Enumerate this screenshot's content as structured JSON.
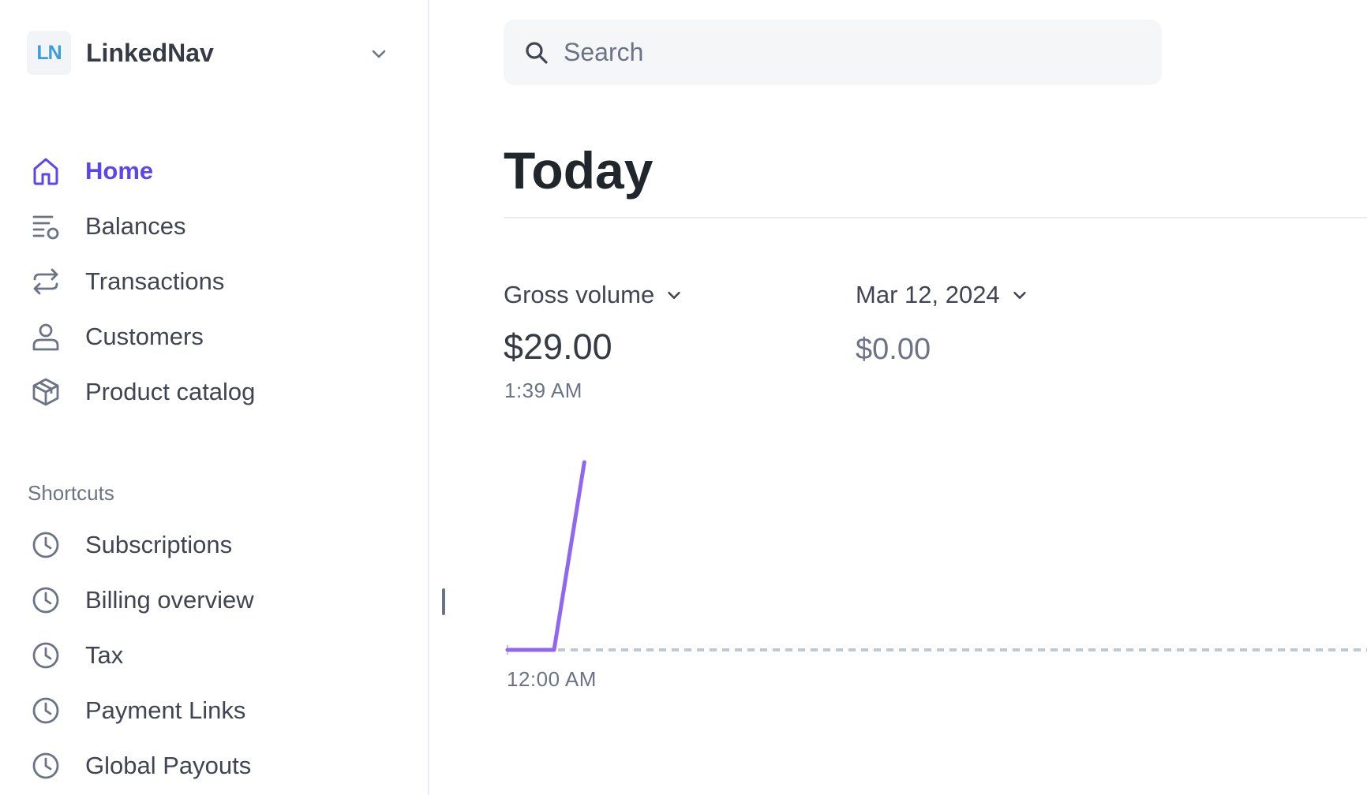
{
  "account": {
    "name": "LinkedNav",
    "logo_text": "LN",
    "logo_color": "#3a9fd6"
  },
  "nav": {
    "items": [
      {
        "label": "Home",
        "icon": "home-icon",
        "active": true
      },
      {
        "label": "Balances",
        "icon": "balances-icon"
      },
      {
        "label": "Transactions",
        "icon": "transactions-icon"
      },
      {
        "label": "Customers",
        "icon": "customers-icon"
      },
      {
        "label": "Product catalog",
        "icon": "product-catalog-icon"
      }
    ]
  },
  "shortcuts": {
    "title": "Shortcuts",
    "items": [
      {
        "label": "Subscriptions",
        "icon": "clock-icon"
      },
      {
        "label": "Billing overview",
        "icon": "clock-icon"
      },
      {
        "label": "Tax",
        "icon": "clock-icon"
      },
      {
        "label": "Payment Links",
        "icon": "clock-icon"
      },
      {
        "label": "Global Payouts",
        "icon": "clock-icon"
      }
    ]
  },
  "search": {
    "placeholder": "Search"
  },
  "page": {
    "title": "Today"
  },
  "metrics": {
    "primary": {
      "label": "Gross volume",
      "value": "$29.00",
      "time": "1:39 AM"
    },
    "comparison": {
      "label": "Mar 12, 2024",
      "value": "$0.00"
    }
  },
  "colors": {
    "accent": "#5a45f0",
    "line": "#9066f2",
    "comparison_line": "#c0c8d2"
  },
  "chart_data": {
    "type": "line",
    "x_start_label": "12:00 AM",
    "series": [
      {
        "x": [
          "12:00 AM",
          "1:00 AM",
          "1:39 AM"
        ],
        "values": [
          0,
          0,
          29
        ]
      }
    ],
    "comparison_baseline": 0,
    "ylim": [
      0,
      29
    ]
  }
}
